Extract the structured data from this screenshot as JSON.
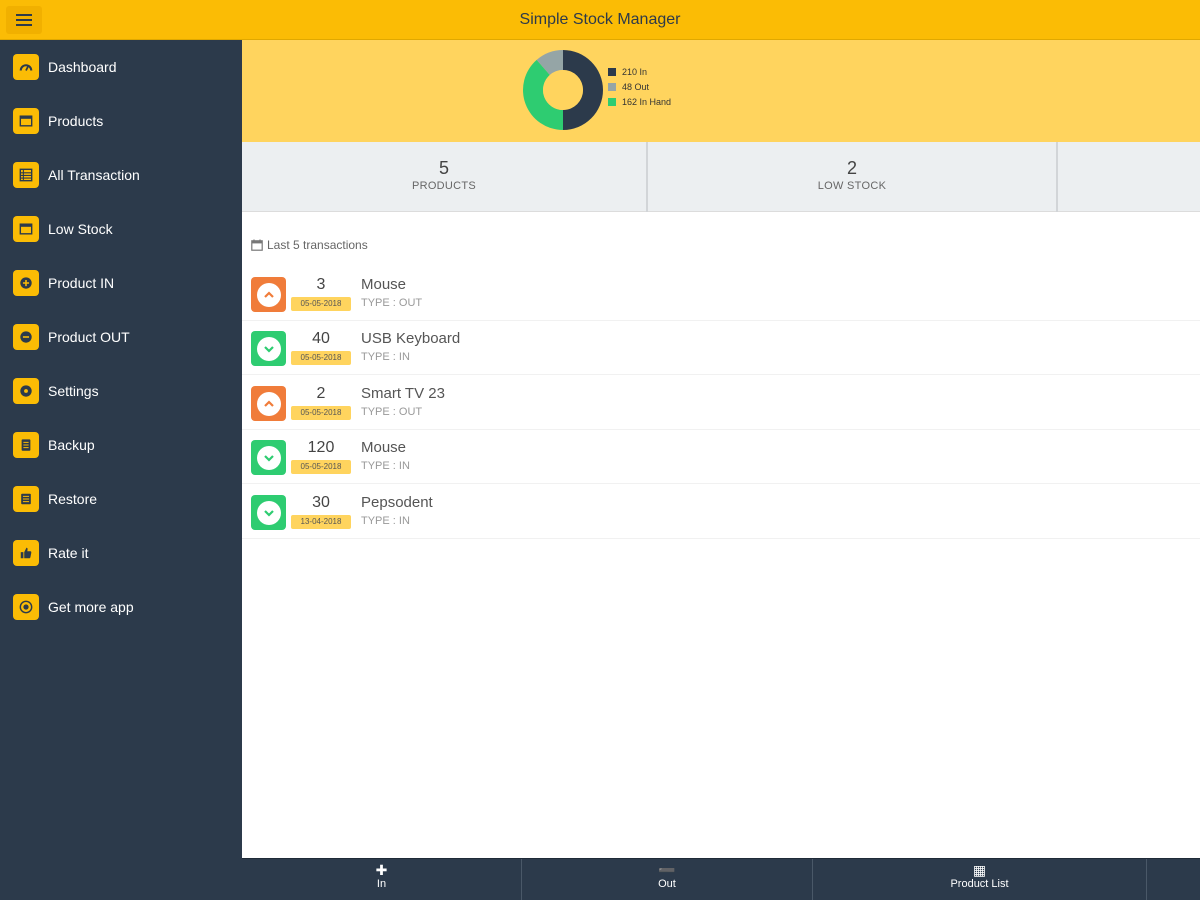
{
  "app": {
    "title": "Simple Stock Manager"
  },
  "sidebar": {
    "items": [
      {
        "label": "Dashboard",
        "icon": "dashboard-icon"
      },
      {
        "label": "Products",
        "icon": "products-icon"
      },
      {
        "label": "All Transaction",
        "icon": "list-icon"
      },
      {
        "label": "Low Stock",
        "icon": "low-stock-icon"
      },
      {
        "label": "Product IN",
        "icon": "plus-circle-icon"
      },
      {
        "label": "Product OUT",
        "icon": "minus-circle-icon"
      },
      {
        "label": "Settings",
        "icon": "gear-icon"
      },
      {
        "label": "Backup",
        "icon": "backup-icon"
      },
      {
        "label": "Restore",
        "icon": "restore-icon"
      },
      {
        "label": "Rate it",
        "icon": "thumbs-up-icon"
      },
      {
        "label": "Get more app",
        "icon": "more-apps-icon"
      }
    ]
  },
  "chart_data": {
    "type": "pie",
    "categories": [
      "In",
      "Out",
      "In Hand"
    ],
    "values": [
      210,
      48,
      162
    ],
    "legend": [
      "210 In",
      "48 Out",
      "162 In Hand"
    ],
    "colors": [
      "#2c3a4b",
      "#95a5a6",
      "#2ecc71"
    ],
    "legend_position": "right"
  },
  "stats": [
    {
      "value": "5",
      "label": "PRODUCTS"
    },
    {
      "value": "2",
      "label": "LOW STOCK"
    }
  ],
  "transactions": {
    "title": "Last 5 transactions",
    "items": [
      {
        "qty": "3",
        "date": "05-05-2018",
        "name": "Mouse",
        "type": "TYPE : OUT",
        "direction": "out"
      },
      {
        "qty": "40",
        "date": "05-05-2018",
        "name": "USB Keyboard",
        "type": "TYPE : IN",
        "direction": "in"
      },
      {
        "qty": "2",
        "date": "05-05-2018",
        "name": "Smart TV 23",
        "type": "TYPE : OUT",
        "direction": "out"
      },
      {
        "qty": "120",
        "date": "05-05-2018",
        "name": "Mouse",
        "type": "TYPE : IN",
        "direction": "in"
      },
      {
        "qty": "30",
        "date": "13-04-2018",
        "name": "Pepsodent",
        "type": "TYPE : IN",
        "direction": "in"
      }
    ]
  },
  "bottombar": {
    "buttons": [
      {
        "label": "In",
        "icon": "plus-icon"
      },
      {
        "label": "Out",
        "icon": "minus-icon"
      },
      {
        "label": "Product List",
        "icon": "grid-icon"
      }
    ]
  },
  "colors": {
    "accent": "#fbbc05",
    "sidebar": "#2c3a4b",
    "out": "#f07c3a",
    "in": "#2ecc71"
  }
}
